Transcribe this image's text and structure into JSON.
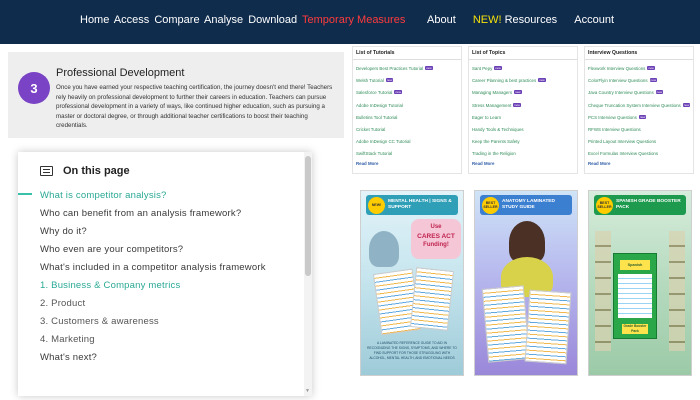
{
  "nav": {
    "left_items": [
      "Home",
      "Access",
      "Compare",
      "Analyse",
      "Download"
    ],
    "left_highlight": "Temporary Measures",
    "about": "About",
    "new_tag": "NEW!",
    "resources": "Resources",
    "account": "Account",
    "highlight_color": "#ff3b3b",
    "new_color": "#f6e10a"
  },
  "pd": {
    "number": "3",
    "title": "Professional Development",
    "text": "Once you have earned your respective teaching certification, the journey doesn't end there! Teachers rely heavily on professional development to further their careers in education. Teachers can pursue professional development in a variety of ways, like continued higher education, such as pursuing a master or doctoral degree, or through additional teacher certifications to boost their teaching credentials."
  },
  "toc": {
    "title": "On this page",
    "items": [
      {
        "label": "What is competitor analysis?",
        "state": "active"
      },
      {
        "label": "Who can benefit from an analysis framework?",
        "state": ""
      },
      {
        "label": "Why do it?",
        "state": ""
      },
      {
        "label": "Who even are your competitors?",
        "state": ""
      },
      {
        "label": "What's included in a competitor analysis framework",
        "state": ""
      },
      {
        "label": "1. Business & Company metrics",
        "state": "sub hl"
      },
      {
        "label": "2. Product",
        "state": "sub"
      },
      {
        "label": "3. Customers & awareness",
        "state": "sub"
      },
      {
        "label": "4. Marketing",
        "state": "sub"
      },
      {
        "label": "What's next?",
        "state": ""
      }
    ]
  },
  "boxes": [
    {
      "title": "List of Tutorials",
      "items": [
        {
          "label": "Developers Best Practices Tutorial",
          "tag": "new"
        },
        {
          "label": "Welsh Tutorial",
          "tag": "new"
        },
        {
          "label": "Salesforce Tutorial",
          "tag": "new"
        },
        {
          "label": "Adobe InDesign Tutorial",
          "tag": ""
        },
        {
          "label": "Bulletins Tool Tutorial",
          "tag": ""
        },
        {
          "label": "Cricket Tutorial",
          "tag": ""
        },
        {
          "label": "Adobe InDesign CC Tutorial",
          "tag": ""
        },
        {
          "label": "SwiftStack Tutorial",
          "tag": ""
        }
      ],
      "more": "Read More"
    },
    {
      "title": "List of Topics",
      "items": [
        {
          "label": "Sant Pepy",
          "tag": "new"
        },
        {
          "label": "Career Planning & best practices",
          "tag": "new"
        },
        {
          "label": "Managing Managers",
          "tag": "new"
        },
        {
          "label": "Stress Management",
          "tag": "new"
        },
        {
          "label": "Eager to Learn",
          "tag": ""
        },
        {
          "label": "Handy Tools & Techniques",
          "tag": ""
        },
        {
          "label": "Keep the Parents Safety",
          "tag": ""
        },
        {
          "label": "Trading in the Religion",
          "tag": ""
        }
      ],
      "more": "Read More"
    },
    {
      "title": "Interview Questions",
      "items": [
        {
          "label": "Flexwork Interview Questions",
          "tag": "new"
        },
        {
          "label": "ColorFlyin Interview Questions",
          "tag": "new"
        },
        {
          "label": "Java Country Interview Questions",
          "tag": "new"
        },
        {
          "label": "Cheque Truncation System Interview Questions",
          "tag": "new"
        },
        {
          "label": "PCS Interview Questions",
          "tag": "new"
        },
        {
          "label": "RFWS Interview Questions",
          "tag": ""
        },
        {
          "label": "Printed Layout Interview Questions",
          "tag": ""
        },
        {
          "label": "Excel Formulas Interview Questions",
          "tag": ""
        }
      ],
      "more": "Read More"
    }
  ],
  "covers": [
    {
      "badge": "NEW!",
      "title": "MENTAL HEALTH | SIGNS & SUPPORT",
      "callout_top": "Use",
      "callout_mid": "CARES ACT",
      "callout_bottom": "Funding!",
      "caption": "A LAMINATED REFERENCE GUIDE TO AID IN RECOGNIZING THE SIGNS, SYMPTOMS, AND WHERE TO FIND SUPPORT FOR THOSE STRUGGLING WITH ALCOHOL, MENTAL HEALTH, AND EMOTIONAL NEEDS"
    },
    {
      "badge": "BEST SELLER",
      "title": "ANATOMY LAMINATED STUDY GUIDE"
    },
    {
      "badge": "BEST SELLER",
      "title": "SPANISH GRADE BOOSTER PACK",
      "book_label": "Spanish",
      "book_foot": "Grade Booster Pack"
    }
  ]
}
